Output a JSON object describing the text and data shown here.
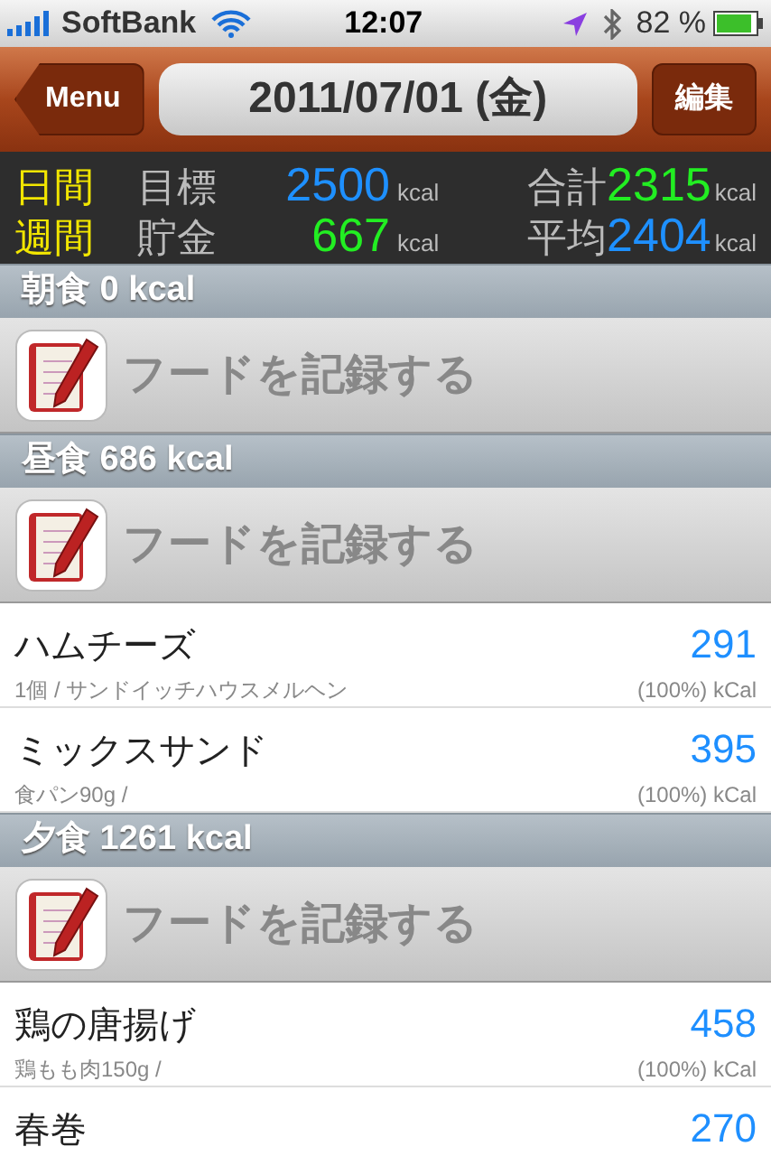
{
  "status_bar": {
    "carrier": "SoftBank",
    "time": "12:07",
    "battery": "82 %"
  },
  "nav": {
    "back": "Menu",
    "title": "2011/07/01 (金)",
    "edit": "編集"
  },
  "summary": [
    {
      "period": "日間",
      "cells": [
        {
          "label": "目標",
          "value": "2500",
          "unit": "kcal",
          "color": "#1e90ff"
        },
        {
          "label": "合計",
          "value": "2315",
          "unit": "kcal",
          "color": "#22ee22"
        }
      ]
    },
    {
      "period": "週間",
      "cells": [
        {
          "label": "貯金",
          "value": "667",
          "unit": "kcal",
          "color": "#22ee22"
        },
        {
          "label": "平均",
          "value": "2404",
          "unit": "kcal",
          "color": "#1e90ff"
        }
      ]
    }
  ],
  "sections": [
    {
      "title": "朝食 0 kcal",
      "add": "フードを記録する"
    },
    {
      "title": "昼食 686 kcal",
      "add": "フードを記録する",
      "items": [
        {
          "name": "ハムチーズ",
          "detail": "1個 / サンドイッチハウスメルヘン",
          "kcal": "291",
          "unit": "(100%) kCal"
        },
        {
          "name": "ミックスサンド",
          "detail": "食パン90g /",
          "kcal": "395",
          "unit": "(100%) kCal"
        }
      ]
    },
    {
      "title": "夕食 1261 kcal",
      "add": "フードを記録する",
      "items": [
        {
          "name": "鶏の唐揚げ",
          "detail": "鶏もも肉150g /",
          "kcal": "458",
          "unit": "(100%) kCal"
        },
        {
          "name": "春巻",
          "kcal": "270"
        }
      ]
    }
  ]
}
